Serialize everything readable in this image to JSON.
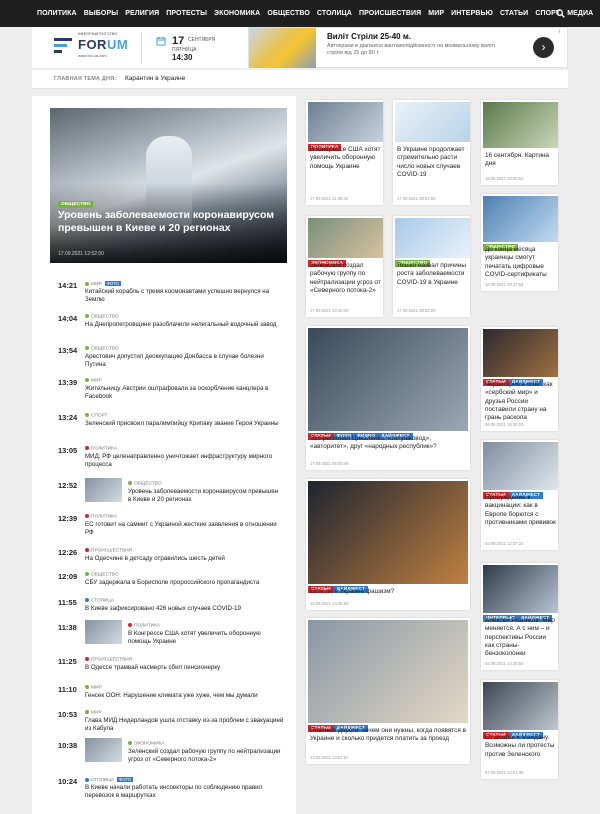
{
  "nav": {
    "items": [
      "ПОЛИТИКА",
      "ВЫБОРЫ",
      "РЕЛИГИЯ",
      "ПРОТЕСТЫ",
      "ЭКОНОМИКА",
      "ОБЩЕСТВО",
      "СТОЛИЦА",
      "ПРОИСШЕСТВИЯ",
      "МИР",
      "ИНТЕРВЬЮ",
      "СТАТЬИ",
      "СПОРТ",
      "МЕДИА"
    ],
    "search_icon": "search-icon"
  },
  "logo": {
    "small": "ИНФОРМАГЕНТСТВО",
    "name_a": "FOR",
    "name_b": "UM",
    "url": "www.for-ua.com"
  },
  "date": {
    "day": "17",
    "month": "СЕНТЯБРЯ",
    "weekday": "ПЯТНИЦА",
    "time": "14:30"
  },
  "ad": {
    "title": "Виліт Стріли 25-40 м.",
    "text": "Автокрани в діапазоні вантажопідйомності на мінімальному виліті стріли від 25 до 80 т",
    "arrow": "›",
    "info": "i"
  },
  "mainbar": {
    "label": "ГЛАВНАЯ ТЕМА ДНЯ:",
    "value": "Карантин в Украине"
  },
  "hero": {
    "tag": "ОБЩЕСТВО",
    "title": "Уровень заболеваемости коронавирусом превышен в Киеве и 20 регионах",
    "date": "17.09.2021 12:52:00"
  },
  "feed": [
    {
      "time": "14:21",
      "cat": "МИР",
      "foto": "ФОТО",
      "text": "Китайский корабль с тремя космонавтами успешно вернулся на Землю",
      "color": "#77b43f"
    },
    {
      "time": "14:04",
      "cat": "ОБЩЕСТВО",
      "text": "На Днепропетровщине разоблачили нелегальный водочный завод",
      "color": "#77b43f"
    },
    {
      "time": "13:54",
      "cat": "ОБЩЕСТВО",
      "text": "Арестович допустил деоккупацию Донбасса в случае болезни Путина",
      "color": "#77b43f"
    },
    {
      "time": "13:39",
      "cat": "МИР",
      "text": "Жительницу Австрии оштрафовали за оскорбление канцлера в Facebook",
      "color": "#77b43f"
    },
    {
      "time": "13:24",
      "cat": "СПОРТ",
      "text": "Зеленский присвоил паралимпийцу Крипаку звание Героя Украины",
      "color": "#77b43f"
    },
    {
      "time": "13:05",
      "cat": "ПОЛИТИКА",
      "text": "МИД: РФ целенаправленно уничтожает инфраструктуру мирного процесса",
      "color": "#d8232a"
    },
    {
      "time": "12:52",
      "cat": "ОБЩЕСТВО",
      "text": "Уровень заболеваемости коронавирусом превышен в Киеве и 20 регионах",
      "color": "#77b43f"
    },
    {
      "time": "12:39",
      "cat": "ПОЛИТИКА",
      "text": "ЕС готовит на саммит с Украиной жесткие заявления в отношении РФ",
      "color": "#d8232a"
    },
    {
      "time": "12:26",
      "cat": "ПРОИСШЕСТВИЯ",
      "text": "На Одесчине в детсаду отравились шесть детей",
      "color": "#d8232a"
    },
    {
      "time": "12:09",
      "cat": "ОБЩЕСТВО",
      "text": "СБУ задержала в Борисполе пророссийского пропагандиста",
      "color": "#77b43f"
    },
    {
      "time": "11:55",
      "cat": "СТОЛИЦА",
      "text": "В Киеве зафиксировано 426 новых случаев COVID-19",
      "color": "#2e7ad1"
    },
    {
      "time": "11:38",
      "cat": "ПОЛИТИКА",
      "text": "В Конгрессе США хотят увеличить оборонную помощь Украине",
      "color": "#d8232a"
    },
    {
      "time": "11:25",
      "cat": "ПРОИСШЕСТВИЯ",
      "text": "В Одессе трамвай насмерть сбил пенсионерку",
      "color": "#d8232a"
    },
    {
      "time": "11:10",
      "cat": "МИР",
      "text": "Генсек ООН: Нарушение климата уже хуже, чем мы думали",
      "color": "#77b43f"
    },
    {
      "time": "10:53",
      "cat": "МИР",
      "text": "Глава МИД Нидерландов ушла отставку из-за проблем с эвакуацией из Кабула",
      "color": "#77b43f"
    },
    {
      "time": "10:38",
      "cat": "ЭКОНОМИКА",
      "text": "Зеленский создал рабочую группу по нейтрализации угроз от «Северного потока-2»",
      "color": "#77b43f"
    },
    {
      "time": "10:24",
      "cat": "СТОЛИЦА",
      "foto": "ФОТО",
      "text": "В Киеве начали работать инспекторы по соблюдению правил перевозок в маршрутках",
      "color": "#2e7ad1"
    }
  ],
  "cards": [
    {
      "tags": [
        "ПОЛИТИКА"
      ],
      "title": "В Конгрессе США хотят увеличить оборонную помощь Украине",
      "date": "17.09.2021 11:38:42"
    },
    {
      "tags": [],
      "title": "В Украине продолжает стремительно расти число новых случаев COVID-19",
      "date": "17.09.2021 08:51:59"
    },
    {
      "tags": [],
      "title": "16 сентября. Картина дня",
      "date": "16.09.2021 22:00:52"
    },
    {
      "tags": [
        "ЭКОНОМИКА"
      ],
      "title": "Зеленский создал рабочую группу по нейтрализации угроз от «Северного потока-2»",
      "date": "17.09.2021 10:40:46"
    },
    {
      "tags": [
        "ОБЩЕСТВО"
      ],
      "title": "Ляшко назвал причины роста заболеваемости COVID-19 в Украине",
      "date": "17.09.2021 08:02:20"
    },
    {
      "tags": [
        "ОБЩЕСТВО"
      ],
      "title": "До конца месяца украинцы смогут печатать цифровые COVID-сертификаты",
      "date": "16.09.2021 19:17:54"
    },
    {
      "tags": [
        "СТАТЬИ",
        "ФОТО",
        "ВИДЕО",
        "ДАЙДЖЕСТ"
      ],
      "title": "Экс-регионал Цикаленко: «титушковод», «авторитет», друг «народных республик»?",
      "date": "17.09.2021 06:00:49"
    },
    {
      "tags": [
        "СТАТЬИ",
        "ДАЙДЖЕСТ"
      ],
      "title": "Черногория в огне: как «сербский мир» и друзья России поставили страну на грань раскола",
      "date": "06.09.2021 15:30:23"
    },
    {
      "tags": [
        "СТАТЬИ",
        "ДАЙДЖЕСТ"
      ],
      "title": "Есть ли в Украине фашизм?",
      "date": "16.09.2021 14:36:59"
    },
    {
      "tags": [
        "СТАТЬИ",
        "ДАЙДЖЕСТ"
      ],
      "title": "Принуждение к вакцинации: как в Европе борются с противниками прививок",
      "date": "03.09.2021 12:07:22"
    },
    {
      "tags": [
        "ИНТЕРВЬЮ",
        "ДАЙДЖЕСТ"
      ],
      "title": "Алексей Резников: Мир меняется. А с ним – и перспективы России как страны-бензоколонки",
      "date": "02.09.2021 14:35:54"
    },
    {
      "tags": [
        "СТАТЬИ",
        "ДАЙДЖЕСТ"
      ],
      "title": "Платные дороги: зачем они нужны, когда появятся в Украине и сколько придется платить за проезд",
      "date": "14.09.2021 14:07:57"
    },
    {
      "tags": [
        "СТАТЬИ",
        "ДАЙДЖЕСТ"
      ],
      "title": "От апатии к Майдану. Возможны ли протесты против Зеленского",
      "date": "07.09.2021 12:51:39"
    }
  ],
  "colors": {
    "green": "#77b43f",
    "red": "#d8232a",
    "blue": "#2e7ad1",
    "nav_bg": "#1f1f1f"
  }
}
